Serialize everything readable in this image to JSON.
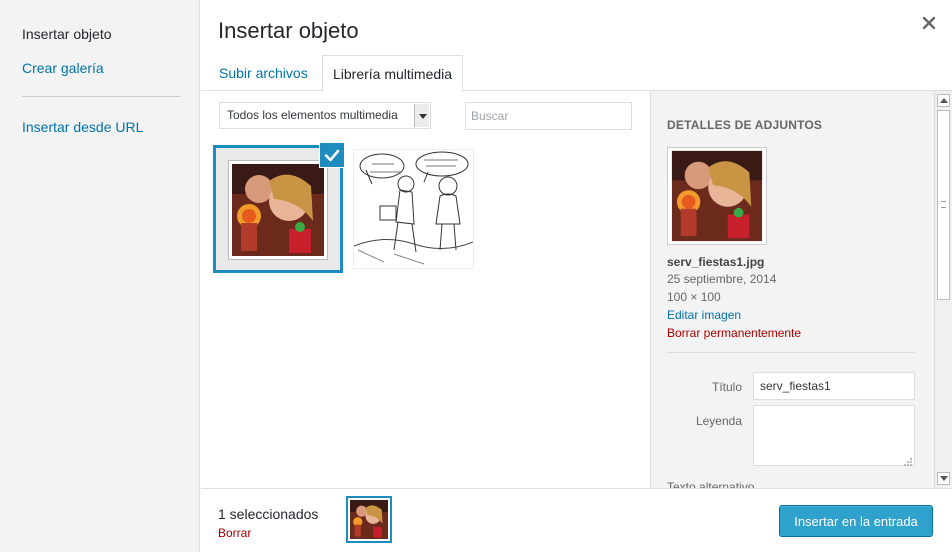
{
  "sidebar": {
    "items": [
      {
        "label": "Insertar objeto"
      },
      {
        "label": "Crear galería"
      },
      {
        "label": "Insertar desde URL"
      }
    ]
  },
  "header": {
    "title": "Insertar objeto"
  },
  "tabs": [
    {
      "label": "Subir archivos"
    },
    {
      "label": "Librería multimedia"
    }
  ],
  "toolbar": {
    "filter_value": "Todos los elementos multimedia",
    "search_placeholder": "Buscar"
  },
  "details": {
    "heading": "Detalles de adjuntos",
    "filename": "serv_fiestas1.jpg",
    "date": "25 septiembre, 2014",
    "dimensions": "100 × 100",
    "edit_link": "Editar imagen",
    "delete_link": "Borrar permanentemente",
    "fields": {
      "title_label": "Título",
      "title_value": "serv_fiestas1",
      "caption_label": "Leyenda",
      "alt_label": "Texto alternativo"
    }
  },
  "footer": {
    "selected_count": "1 seleccionados",
    "clear_link": "Borrar",
    "insert_button": "Insertar en la entrada"
  },
  "colors": {
    "accent": "#1e8cbe",
    "link": "#0073aa",
    "danger": "#aa0000",
    "primary_button": "#2ea2cc"
  }
}
